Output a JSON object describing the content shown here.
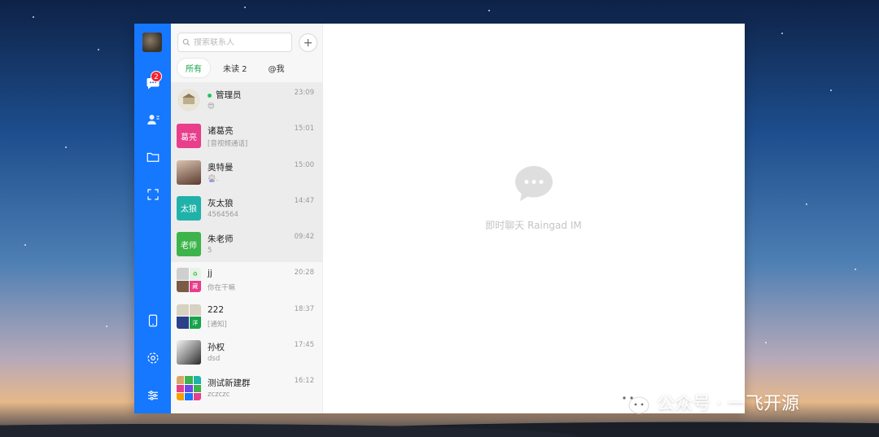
{
  "sidebar": {
    "unread_badge": "2"
  },
  "search": {
    "placeholder": "搜索联系人"
  },
  "tabs": [
    {
      "label": "所有",
      "active": true
    },
    {
      "label": "未读 2",
      "active": false
    },
    {
      "label": "@我",
      "active": false
    }
  ],
  "conversations": [
    {
      "name": "管理员",
      "last_message": "😍",
      "time": "23:09",
      "online": true,
      "avatar_text": ""
    },
    {
      "name": "诸葛亮",
      "last_message": "[音视频通话]",
      "time": "15:01",
      "avatar_text": "葛亮",
      "avatar_color": "#e83e8c"
    },
    {
      "name": "奥特曼",
      "last_message": "🎡.",
      "time": "15:00",
      "avatar_text": ""
    },
    {
      "name": "灰太狼",
      "last_message": "4564564",
      "time": "14:47",
      "avatar_text": "太狼",
      "avatar_color": "#20b2aa"
    },
    {
      "name": "朱老师",
      "last_message": "5",
      "time": "09:42",
      "avatar_text": "老师",
      "avatar_color": "#3cb44b"
    },
    {
      "name": "jj",
      "last_message": "你在干嘛",
      "time": "20:28",
      "avatar_text": ""
    },
    {
      "name": "222",
      "last_message": "[通知]",
      "time": "18:37",
      "avatar_text": ""
    },
    {
      "name": "孙权",
      "last_message": "dsd",
      "time": "17:45",
      "avatar_text": ""
    },
    {
      "name": "测试新建群",
      "last_message": "zczczc",
      "time": "16:12",
      "avatar_text": ""
    }
  ],
  "main": {
    "empty_text": "即时聊天 Raingad IM"
  },
  "watermark": {
    "text": "公众号 · 一飞开源"
  },
  "colors": {
    "rail": "#1677ff",
    "accent": "#16a34a",
    "badge": "#f5222d"
  }
}
